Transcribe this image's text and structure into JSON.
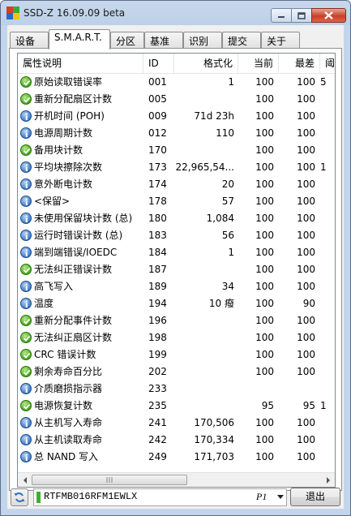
{
  "window": {
    "title": "SSD-Z 16.09.09 beta"
  },
  "tabs": [
    {
      "label": "设备"
    },
    {
      "label": "S.M.A.R.T."
    },
    {
      "label": "分区"
    },
    {
      "label": "基准"
    },
    {
      "label": "识别"
    },
    {
      "label": "提交"
    },
    {
      "label": "关于"
    }
  ],
  "active_tab": "S.M.A.R.T.",
  "columns": [
    {
      "label": "属性说明"
    },
    {
      "label": "ID"
    },
    {
      "label": "格式化"
    },
    {
      "label": "当前"
    },
    {
      "label": "最差"
    },
    {
      "label": "阈"
    }
  ],
  "rows": [
    {
      "icon": "ok",
      "name": "原始读取错误率",
      "id": "001",
      "formatted": "1",
      "current": "100",
      "worst": "100",
      "threshold": "5"
    },
    {
      "icon": "ok",
      "name": "重新分配扇区计数",
      "id": "005",
      "formatted": "",
      "current": "100",
      "worst": "100",
      "threshold": ""
    },
    {
      "icon": "info",
      "name": "开机时间 (POH)",
      "id": "009",
      "formatted": "71d 23h",
      "current": "100",
      "worst": "100",
      "threshold": ""
    },
    {
      "icon": "info",
      "name": "电源周期计数",
      "id": "012",
      "formatted": "110",
      "current": "100",
      "worst": "100",
      "threshold": ""
    },
    {
      "icon": "ok",
      "name": "备用块计数",
      "id": "170",
      "formatted": "",
      "current": "100",
      "worst": "100",
      "threshold": ""
    },
    {
      "icon": "info",
      "name": "平均块擦除次数",
      "id": "173",
      "formatted": "22,965,54...",
      "current": "100",
      "worst": "100",
      "threshold": "1"
    },
    {
      "icon": "info",
      "name": "意外断电计数",
      "id": "174",
      "formatted": "20",
      "current": "100",
      "worst": "100",
      "threshold": ""
    },
    {
      "icon": "info",
      "name": "<保留>",
      "id": "178",
      "formatted": "57",
      "current": "100",
      "worst": "100",
      "threshold": ""
    },
    {
      "icon": "info",
      "name": "未使用保留块计数 (总)",
      "id": "180",
      "formatted": "1,084",
      "current": "100",
      "worst": "100",
      "threshold": ""
    },
    {
      "icon": "info",
      "name": "运行时错误计数 (总)",
      "id": "183",
      "formatted": "56",
      "current": "100",
      "worst": "100",
      "threshold": ""
    },
    {
      "icon": "info",
      "name": "端到端错误/IOEDC",
      "id": "184",
      "formatted": "1",
      "current": "100",
      "worst": "100",
      "threshold": ""
    },
    {
      "icon": "ok",
      "name": "无法纠正错误计数",
      "id": "187",
      "formatted": "",
      "current": "100",
      "worst": "100",
      "threshold": ""
    },
    {
      "icon": "info",
      "name": "高飞写入",
      "id": "189",
      "formatted": "34",
      "current": "100",
      "worst": "100",
      "threshold": ""
    },
    {
      "icon": "info",
      "name": "温度",
      "id": "194",
      "formatted": "10 癈",
      "current": "100",
      "worst": "90",
      "threshold": ""
    },
    {
      "icon": "ok",
      "name": "重新分配事件计数",
      "id": "196",
      "formatted": "",
      "current": "100",
      "worst": "100",
      "threshold": ""
    },
    {
      "icon": "ok",
      "name": "无法纠正扇区计数",
      "id": "198",
      "formatted": "",
      "current": "100",
      "worst": "100",
      "threshold": ""
    },
    {
      "icon": "ok",
      "name": "CRC 错误计数",
      "id": "199",
      "formatted": "",
      "current": "100",
      "worst": "100",
      "threshold": ""
    },
    {
      "icon": "ok",
      "name": "剩余寿命百分比",
      "id": "202",
      "formatted": "",
      "current": "100",
      "worst": "100",
      "threshold": ""
    },
    {
      "icon": "info",
      "name": "介质磨损指示器",
      "id": "233",
      "formatted": "",
      "current": "",
      "worst": "",
      "threshold": ""
    },
    {
      "icon": "ok",
      "name": "电源恢复计数",
      "id": "235",
      "formatted": "",
      "current": "95",
      "worst": "95",
      "threshold": "1"
    },
    {
      "icon": "info",
      "name": "从主机写入寿命",
      "id": "241",
      "formatted": "170,506",
      "current": "100",
      "worst": "100",
      "threshold": ""
    },
    {
      "icon": "info",
      "name": "从主机读取寿命",
      "id": "242",
      "formatted": "170,334",
      "current": "100",
      "worst": "100",
      "threshold": ""
    },
    {
      "icon": "info",
      "name": "总 NAND 写入",
      "id": "249",
      "formatted": "171,703",
      "current": "100",
      "worst": "100",
      "threshold": ""
    }
  ],
  "drive_select": {
    "value": "RTFMB016RFM1EWLX",
    "suffix": "P1"
  },
  "exit_label": "退出",
  "colors": {
    "ok": "#46a81d",
    "info": "#3e7cc8",
    "drive_bar": "#3cb02e",
    "close": "#c8412a"
  }
}
